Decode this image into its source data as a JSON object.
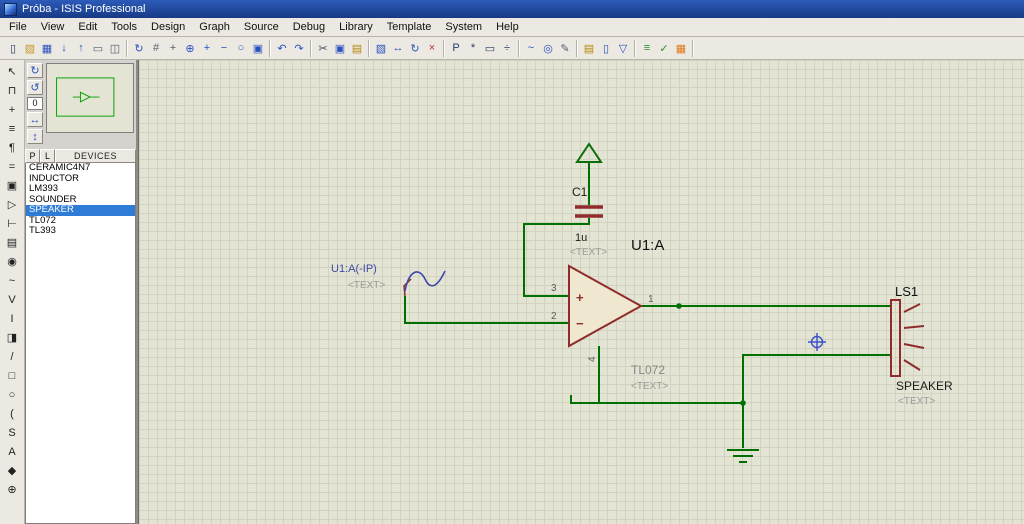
{
  "window": {
    "title": "Próba - ISIS Professional"
  },
  "menu": {
    "items": [
      "File",
      "View",
      "Edit",
      "Tools",
      "Design",
      "Graph",
      "Source",
      "Debug",
      "Library",
      "Template",
      "System",
      "Help"
    ]
  },
  "toolbar": {
    "groups": [
      [
        {
          "name": "new-design-icon",
          "glyph": "▯",
          "color": "#223a66"
        },
        {
          "name": "open-design-icon",
          "glyph": "▨",
          "color": "#c79a2e"
        },
        {
          "name": "save-design-icon",
          "glyph": "▦",
          "color": "#2a52be"
        },
        {
          "name": "import-section-icon",
          "glyph": "↓",
          "color": "#2a52be"
        },
        {
          "name": "export-section-icon",
          "glyph": "↑",
          "color": "#2a52be"
        },
        {
          "name": "print-icon",
          "glyph": "▭",
          "color": "#55606e"
        },
        {
          "name": "mark-output-area-icon",
          "glyph": "◫",
          "color": "#55606e"
        }
      ],
      [
        {
          "name": "redraw-icon",
          "glyph": "↻",
          "color": "#2a52be"
        },
        {
          "name": "toggle-grid-icon",
          "glyph": "#",
          "color": "#55606e"
        },
        {
          "name": "false-origin-icon",
          "glyph": "+",
          "color": "#55606e"
        },
        {
          "name": "center-at-cursor-icon",
          "glyph": "⊕",
          "color": "#2a52be"
        },
        {
          "name": "zoom-in-icon",
          "glyph": "+",
          "color": "#2a52be"
        },
        {
          "name": "zoom-out-icon",
          "glyph": "−",
          "color": "#2a52be"
        },
        {
          "name": "zoom-all-icon",
          "glyph": "○",
          "color": "#2a52be"
        },
        {
          "name": "zoom-area-icon",
          "glyph": "▣",
          "color": "#2a52be"
        }
      ],
      [
        {
          "name": "undo-icon",
          "glyph": "↶",
          "color": "#2a52be"
        },
        {
          "name": "redo-icon",
          "glyph": "↷",
          "color": "#2a52be"
        }
      ],
      [
        {
          "name": "cut-icon",
          "glyph": "✂",
          "color": "#444e5c"
        },
        {
          "name": "copy-icon",
          "glyph": "▣",
          "color": "#2a52be"
        },
        {
          "name": "paste-icon",
          "glyph": "▤",
          "color": "#b8860b"
        }
      ],
      [
        {
          "name": "copy-block-icon",
          "glyph": "▧",
          "color": "#2a52be"
        },
        {
          "name": "move-block-icon",
          "glyph": "↔",
          "color": "#2a52be"
        },
        {
          "name": "rotate-block-icon",
          "glyph": "↻",
          "color": "#2a52be"
        },
        {
          "name": "delete-block-icon",
          "glyph": "×",
          "color": "#c03030"
        }
      ],
      [
        {
          "name": "pick-parts-icon",
          "glyph": "P",
          "color": "#223a66"
        },
        {
          "name": "make-device-icon",
          "glyph": "*",
          "color": "#223a66"
        },
        {
          "name": "packaging-tool-icon",
          "glyph": "▭",
          "color": "#223a66"
        },
        {
          "name": "decompose-icon",
          "glyph": "÷",
          "color": "#223a66"
        }
      ],
      [
        {
          "name": "wire-autorouter-icon",
          "glyph": "~",
          "color": "#2a52be"
        },
        {
          "name": "search-tag-icon",
          "glyph": "◎",
          "color": "#2a52be"
        },
        {
          "name": "property-assignment-icon",
          "glyph": "✎",
          "color": "#55606e"
        }
      ],
      [
        {
          "name": "design-explorer-icon",
          "glyph": "▤",
          "color": "#b8860b"
        },
        {
          "name": "new-sheet-icon",
          "glyph": "▯",
          "color": "#2a52be"
        },
        {
          "name": "remove-sheet-icon",
          "glyph": "▽",
          "color": "#2a52be"
        }
      ],
      [
        {
          "name": "bill-of-materials-icon",
          "glyph": "≡",
          "color": "#2e8b2e"
        },
        {
          "name": "electrical-rules-check-icon",
          "glyph": "✓",
          "color": "#2e8b2e"
        },
        {
          "name": "netlist-to-ares-icon",
          "glyph": "▦",
          "color": "#e07818"
        }
      ]
    ]
  },
  "tools": {
    "items": [
      {
        "name": "selection-tool",
        "glyph": "↖"
      },
      {
        "name": "component-tool",
        "glyph": "⊓"
      },
      {
        "name": "junction-dot-tool",
        "glyph": "+"
      },
      {
        "name": "wire-label-tool",
        "glyph": "≡"
      },
      {
        "name": "text-script-tool",
        "glyph": "¶"
      },
      {
        "name": "bus-tool",
        "glyph": "="
      },
      {
        "name": "subcircuit-tool",
        "glyph": "▣"
      },
      {
        "name": "terminal-tool",
        "glyph": "▷"
      },
      {
        "name": "device-pin-tool",
        "glyph": "⊢"
      },
      {
        "name": "graph-tool",
        "glyph": "▤"
      },
      {
        "name": "tape-recorder-tool",
        "glyph": "◉"
      },
      {
        "name": "generator-tool",
        "glyph": "~"
      },
      {
        "name": "voltage-probe-tool",
        "glyph": "V"
      },
      {
        "name": "current-probe-tool",
        "glyph": "I"
      },
      {
        "name": "virtual-instruments-tool",
        "glyph": "◨"
      },
      {
        "name": "line-2d-tool",
        "glyph": "/"
      },
      {
        "name": "box-2d-tool",
        "glyph": "□"
      },
      {
        "name": "circle-2d-tool",
        "glyph": "○"
      },
      {
        "name": "arc-2d-tool",
        "glyph": "("
      },
      {
        "name": "path-2d-tool",
        "glyph": "S"
      },
      {
        "name": "text-2d-tool",
        "glyph": "A"
      },
      {
        "name": "symbol-2d-tool",
        "glyph": "◆"
      },
      {
        "name": "marker-2d-tool",
        "glyph": "⊕"
      }
    ]
  },
  "side": {
    "rotate": {
      "redraw": "↻",
      "rotate_ccw": "↺",
      "angle": "0",
      "mirror_h": "↔",
      "mirror_v": "↕"
    },
    "devices": {
      "p": "P",
      "l": "L",
      "header": "DEVICES",
      "items": [
        {
          "label": "CERAMIC4N7",
          "selected": false
        },
        {
          "label": "INDUCTOR",
          "selected": false
        },
        {
          "label": "LM393",
          "selected": false
        },
        {
          "label": "SOUNDER",
          "selected": false
        },
        {
          "label": "SPEAKER",
          "selected": true
        },
        {
          "label": "TL072",
          "selected": false
        },
        {
          "label": "TL393",
          "selected": false
        }
      ]
    }
  },
  "schematic": {
    "cap": {
      "ref": "C1",
      "value": "1u",
      "text": "<TEXT>"
    },
    "opamp": {
      "ref": "U1:A",
      "value": "TL072",
      "text": "<TEXT>",
      "pin_out": "1",
      "pin_inv": "2",
      "pin_noninv": "3",
      "pin_gnd": "4",
      "plus": "+",
      "minus": "−"
    },
    "input": {
      "ref": "U1:A(-IP)",
      "text": "<TEXT>"
    },
    "speaker": {
      "ref": "LS1",
      "value": "SPEAKER",
      "text": "<TEXT>"
    }
  },
  "colors": {
    "titlebar_top": "#2d5bb9",
    "titlebar_bottom": "#173a85",
    "canvas_bg": "#e4e4d4",
    "grid": "#d2d2c0",
    "wire": "#007000",
    "component": "#8f2b2b",
    "select": "#2f7cd6",
    "input_label": "#3f49a6",
    "target": "#3c50c8"
  }
}
